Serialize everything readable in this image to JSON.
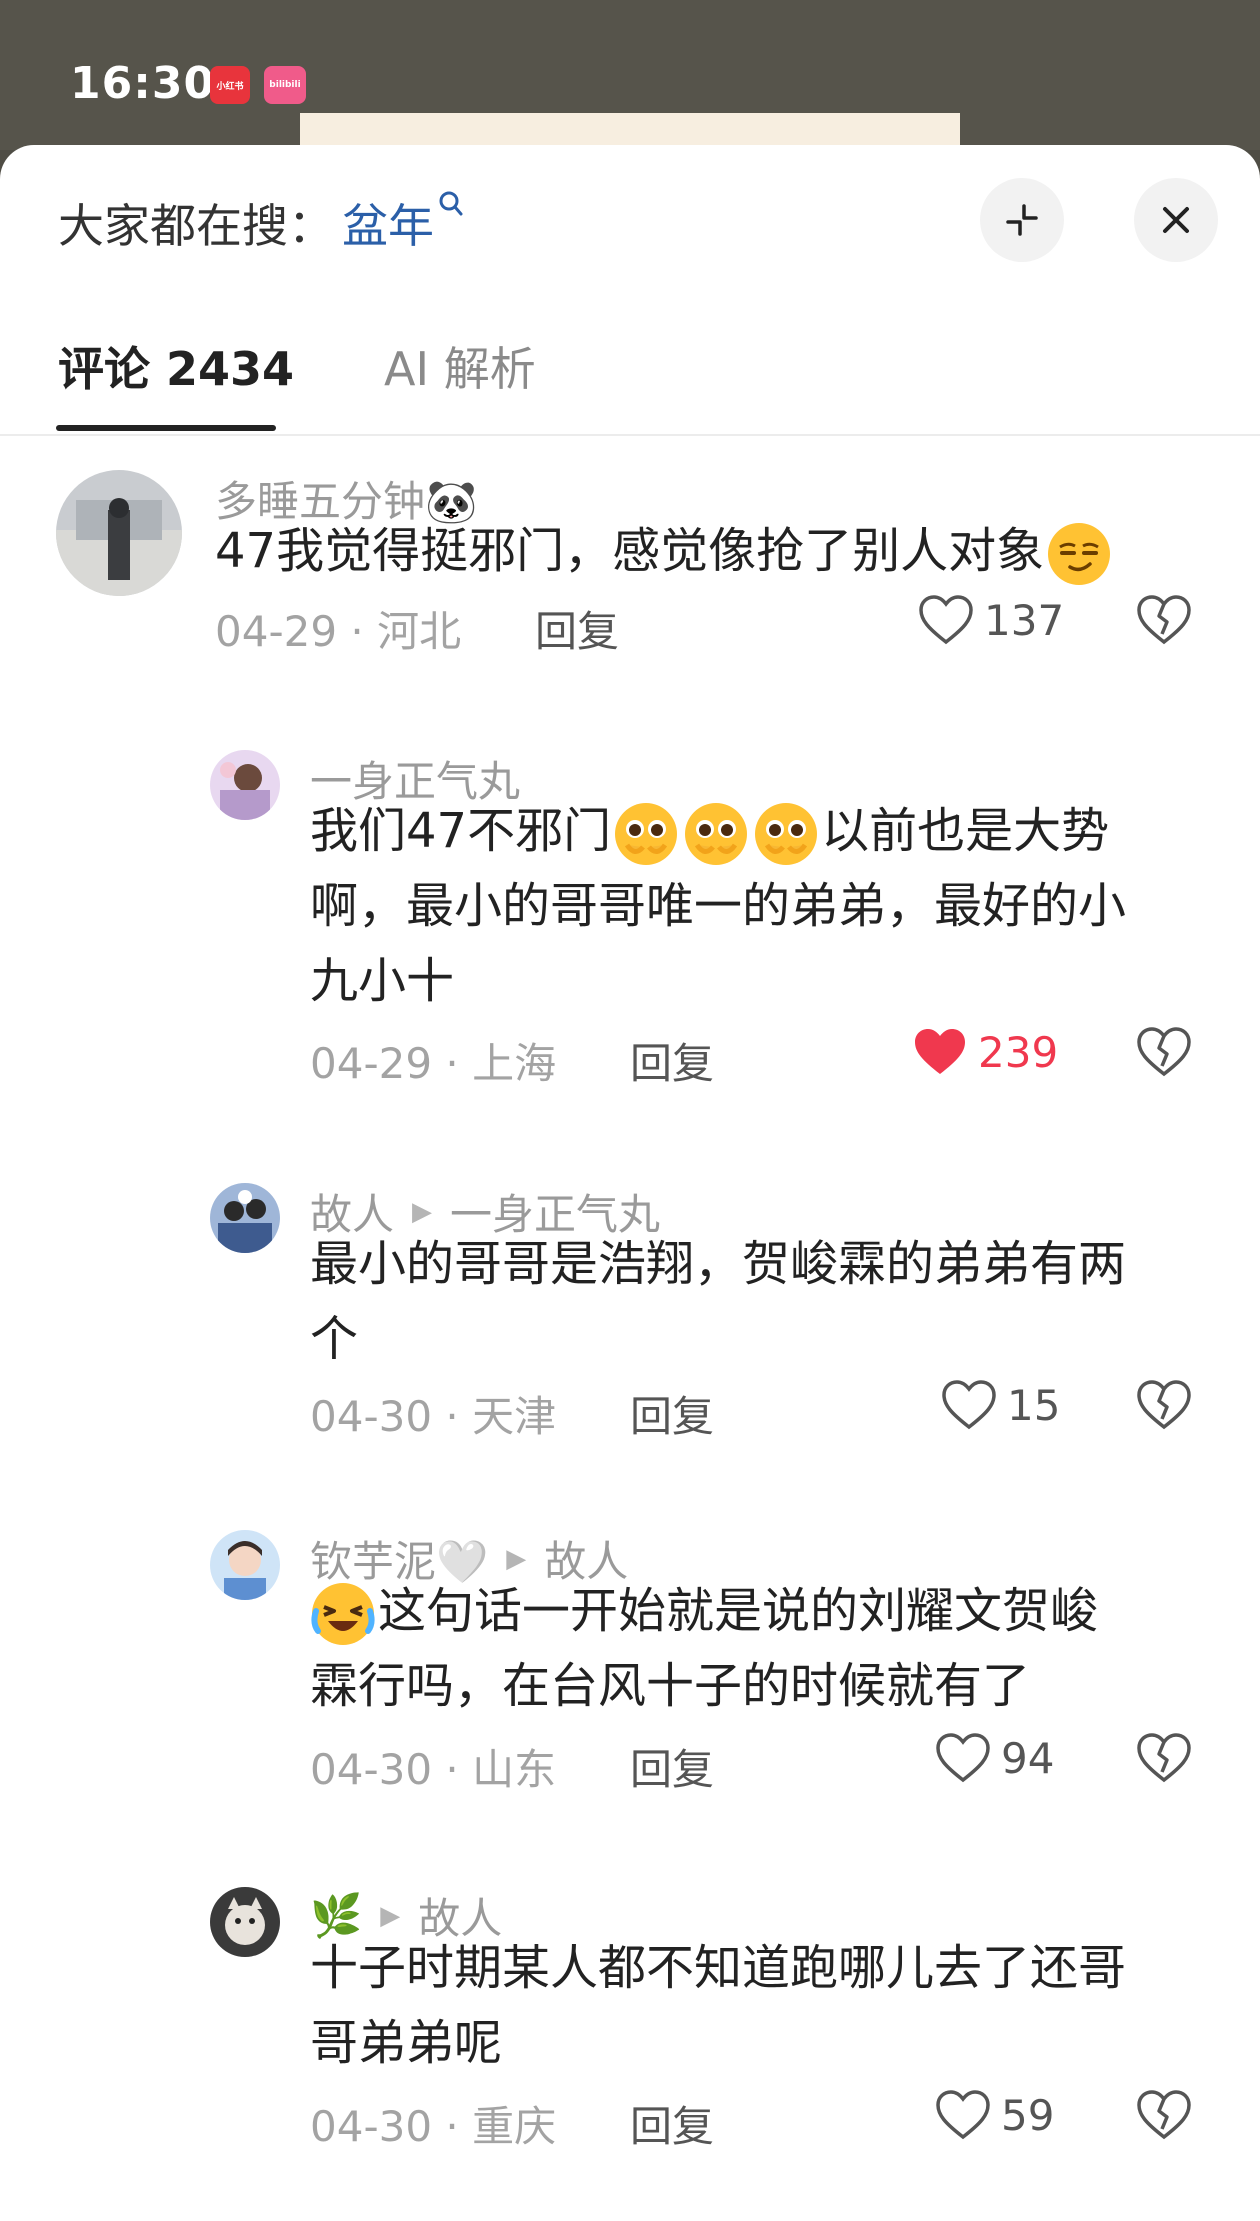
{
  "status_bar": {
    "time": "16:30",
    "badges": [
      "小红书",
      "bilibili"
    ]
  },
  "header": {
    "search_prefix": "大家都在搜：",
    "search_keyword": "盆年",
    "search_icon": "search-icon",
    "collapse_icon": "collapse-icon",
    "close_icon": "close-icon"
  },
  "tabs": [
    {
      "label": "评论 2434",
      "active": true
    },
    {
      "label": "AI 解析",
      "active": false
    }
  ],
  "comments": [
    {
      "username": "多睡五分钟🐼",
      "reply_to": "",
      "text_parts": [
        "47我觉得挺邪门，感觉像抢了别人对象"
      ],
      "emoji": "smirk-face-emoji",
      "date": "04-29",
      "location": "河北",
      "meta": "04-29 · 河北",
      "reply_label": "回复",
      "likes": "137",
      "liked": false
    },
    {
      "username": "一身正气丸",
      "reply_to": "",
      "text_lines": [
        "我们47不邪门🥹🥹🥹以前也是大势",
        "啊，最小的哥哥唯一的弟弟，最好的小",
        "九小十"
      ],
      "text_start": "我们47不邪门",
      "text_end": "以前也是大势",
      "text_line2": "啊，最小的哥哥唯一的弟弟，最好的小",
      "text_line3": "九小十",
      "emoji": "pleading-face-emoji",
      "meta": "04-29 · 上海",
      "reply_label": "回复",
      "likes": "239",
      "liked": true
    },
    {
      "username": "故人",
      "reply_to": "一身正气丸",
      "text_line1": "最小的哥哥是浩翔，贺峻霖的弟弟有两",
      "text_line2": "个",
      "meta": "04-30 · 天津",
      "reply_label": "回复",
      "likes": "15",
      "liked": false
    },
    {
      "username": "钦芋泥🤍",
      "reply_to": "故人",
      "text_line1": "这句话一开始就是说的刘耀文贺峻",
      "text_line2": "霖行吗，在台风十子的时候就有了",
      "emoji": "rofl-face-emoji",
      "meta": "04-30 · 山东",
      "reply_label": "回复",
      "likes": "94",
      "liked": false
    },
    {
      "username": "🌿",
      "reply_to": "故人",
      "text_line1": "十子时期某人都不知道跑哪儿去了还哥",
      "text_line2": "哥弟弟呢",
      "meta": "04-30 · 重庆",
      "reply_label": "回复",
      "likes": "59",
      "liked": false
    }
  ],
  "colors": {
    "liked_red": "#f0384e",
    "keyword_blue": "#2b5fa8",
    "muted_gray": "#9a9a9a"
  }
}
